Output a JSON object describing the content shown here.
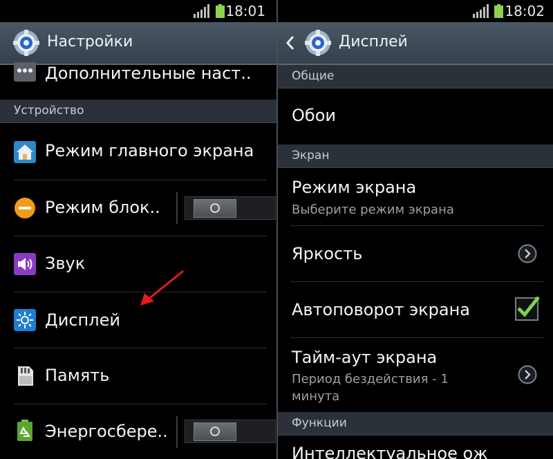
{
  "left_screen": {
    "status_time": "18:01",
    "title": "Настройки",
    "items": [
      {
        "label": "Дополнительные наст.."
      },
      {
        "section": "Устройство"
      },
      {
        "label": "Режим главного экрана"
      },
      {
        "label": "Режим блок.."
      },
      {
        "label": "Звук"
      },
      {
        "label": "Дисплей"
      },
      {
        "label": "Память"
      },
      {
        "label": "Энергосбере.."
      }
    ],
    "toggles": {
      "blocking_mode": "off",
      "power_saving": "off"
    }
  },
  "right_screen": {
    "status_time": "18:02",
    "title": "Дисплей",
    "sections": {
      "general": "Общие",
      "screen": "Экран",
      "functions": "Функции"
    },
    "items": {
      "wallpaper": {
        "label": "Обои"
      },
      "screen_mode": {
        "label": "Режим экрана",
        "summary": "Выберите режим экрана"
      },
      "brightness": {
        "label": "Яркость"
      },
      "auto_rotate": {
        "label": "Автоповорот экрана",
        "checked": true
      },
      "timeout": {
        "label": "Тайм-аут экрана",
        "summary_line1": "Период бездействия - 1",
        "summary_line2": "минута"
      },
      "smart_stay": {
        "label": "Интеллектуальное ож"
      }
    }
  },
  "colors": {
    "action_bar": "#3e4a56",
    "section_header": "#2a3138",
    "checkbox_check": "#7fd44a",
    "annotation_arrow": "#e11b1b"
  }
}
